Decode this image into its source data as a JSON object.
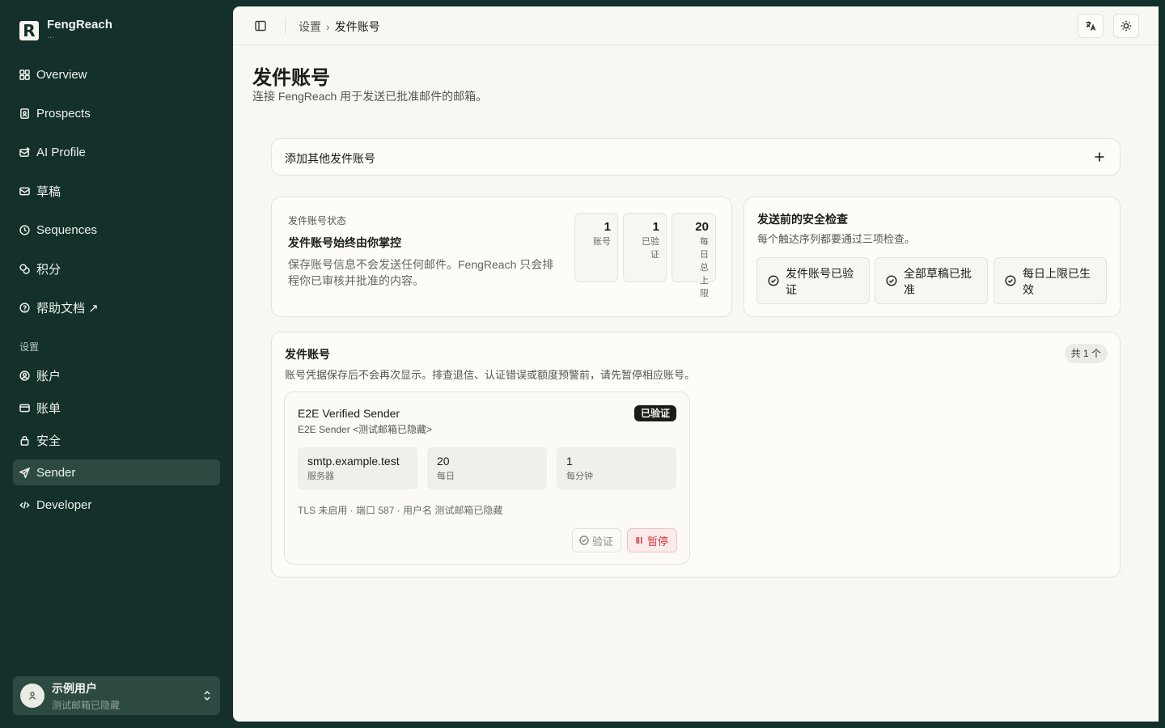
{
  "brand": {
    "name": "FengReach",
    "sub": "..."
  },
  "nav": {
    "items": [
      {
        "label": "Overview",
        "icon": "grid-icon"
      },
      {
        "label": "Prospects",
        "icon": "contacts-icon"
      },
      {
        "label": "AI Profile",
        "icon": "ai-profile-icon"
      },
      {
        "label": "草稿",
        "icon": "mail-draft-icon"
      },
      {
        "label": "Sequences",
        "icon": "clock-icon"
      },
      {
        "label": "积分",
        "icon": "coins-icon"
      },
      {
        "label": "帮助文档 ↗",
        "icon": "help-icon"
      }
    ],
    "settings_label": "设置",
    "settings_items": [
      {
        "label": "账户",
        "icon": "user-circle-icon"
      },
      {
        "label": "账单",
        "icon": "credit-card-icon"
      },
      {
        "label": "安全",
        "icon": "lock-icon"
      },
      {
        "label": "Sender",
        "icon": "send-icon",
        "active": true
      },
      {
        "label": "Developer",
        "icon": "code-icon"
      }
    ]
  },
  "user": {
    "name": "示例用户",
    "email": "测试邮箱已隐藏"
  },
  "topbar": {
    "breadcrumb_parent": "设置",
    "breadcrumb_current": "发件账号"
  },
  "page": {
    "title": "发件账号",
    "subtitle": "连接 FengReach 用于发送已批准邮件的邮箱。"
  },
  "add_account": {
    "label": "添加其他发件账号"
  },
  "status": {
    "kicker": "发件账号状态",
    "headline": "发件账号始终由你掌控",
    "description": "保存账号信息不会发送任何邮件。FengReach 只会排程你已审核并批准的内容。",
    "stats": [
      {
        "value": "1",
        "label": "账号"
      },
      {
        "value": "1",
        "label": "已验证"
      },
      {
        "value": "20",
        "label": "每日总上限"
      }
    ]
  },
  "safety": {
    "title": "发送前的安全检查",
    "subtitle": "每个触达序列都要通过三项检查。",
    "checks": [
      "发件账号已验证",
      "全部草稿已批准",
      "每日上限已生效"
    ]
  },
  "accounts": {
    "title": "发件账号",
    "subtitle": "账号凭据保存后不会再次显示。排查退信、认证错误或额度预警前，请先暂停相应账号。",
    "count_label": "共 1 个",
    "sender": {
      "name": "E2E Verified Sender",
      "from": "E2E Sender <测试邮箱已隐藏>",
      "badge": "已验证",
      "metrics": [
        {
          "value": "smtp.example.test",
          "label": "服务器"
        },
        {
          "value": "20",
          "label": "每日"
        },
        {
          "value": "1",
          "label": "每分钟"
        }
      ],
      "meta": "TLS 未启用 · 端口 587 · 用户名 测试邮箱已隐藏",
      "verify_label": "验证",
      "pause_label": "暂停"
    }
  }
}
